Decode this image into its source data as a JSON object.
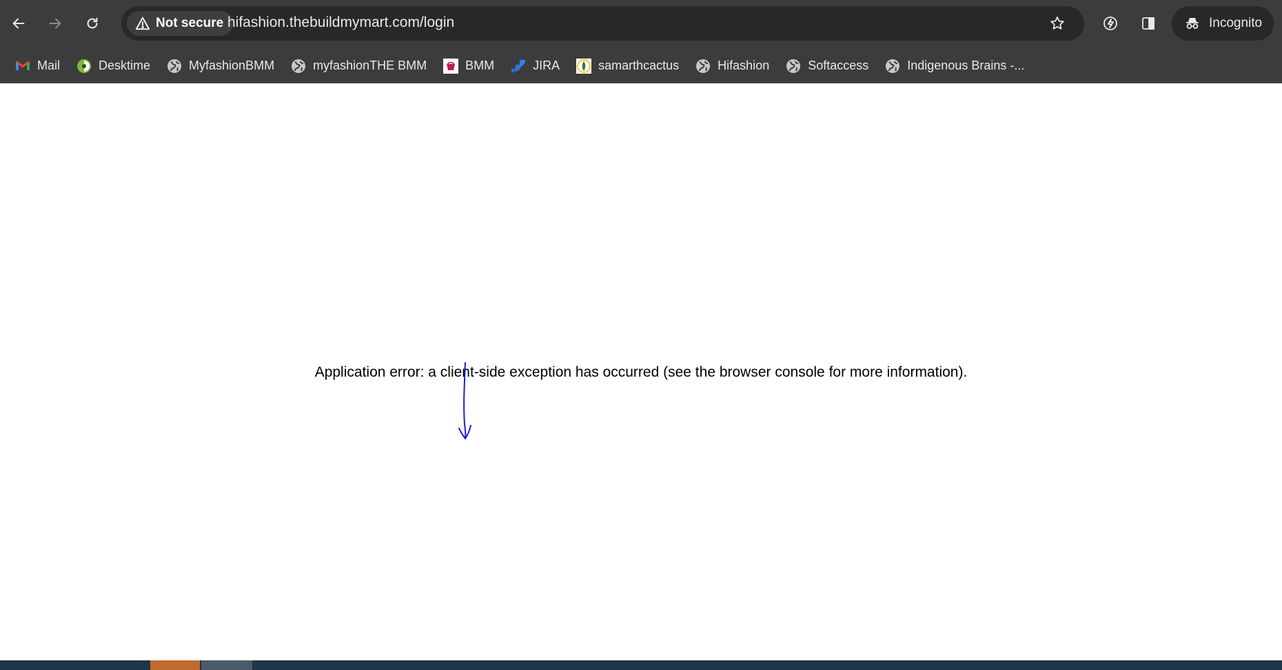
{
  "browser": {
    "url": "hifashion.thebuildmymart.com/login",
    "security_label": "Not secure",
    "incognito_label": "Incognito",
    "colors": {
      "chrome": "#3c3c3c",
      "omnibox": "#282828",
      "text": "#e8eaed"
    }
  },
  "bookmarks": [
    {
      "label": "Mail",
      "icon": "gmail-icon"
    },
    {
      "label": "Desktime",
      "icon": "desktime-icon"
    },
    {
      "label": "MyfashionBMM",
      "icon": "globe-icon"
    },
    {
      "label": "myfashionTHE BMM",
      "icon": "globe-icon"
    },
    {
      "label": "BMM",
      "icon": "bmm-icon"
    },
    {
      "label": "JIRA",
      "icon": "jira-icon"
    },
    {
      "label": "samarthcactus",
      "icon": "samarthcactus-icon"
    },
    {
      "label": "Hifashion",
      "icon": "globe-icon"
    },
    {
      "label": "Softaccess",
      "icon": "globe-icon"
    },
    {
      "label": "Indigenous Brains -...",
      "icon": "globe-icon"
    }
  ],
  "page": {
    "error_message": "Application error: a client-side exception has occurred (see the browser console for more information).",
    "annotation_color": "#1a1ae6"
  }
}
